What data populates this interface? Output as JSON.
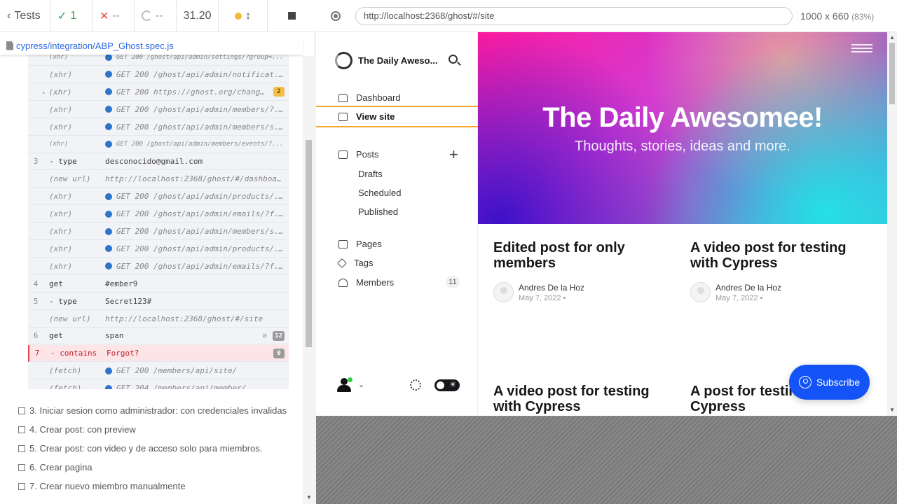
{
  "reporter": {
    "tests_label": "Tests",
    "passed": "1",
    "failed": "--",
    "pending": "--",
    "duration": "31.20",
    "spec_path": "cypress/integration/ABP_Ghost.spec.js"
  },
  "commands": [
    {
      "num": "",
      "name": "(xhr)",
      "msg": "GET 200 /ghost/api/admin/settings/?group=...",
      "dot": true,
      "style": "faded"
    },
    {
      "num": "",
      "name": "(xhr)",
      "msg": "GET 200 /ghost/api/admin/notificat...",
      "dot": true,
      "style": "italic"
    },
    {
      "num": "",
      "name": "(xhr)",
      "msg": "GET 200 https://ghost.org/change...",
      "dot": true,
      "style": "italic",
      "badge": "2",
      "badge_color": "yellow",
      "caret": true
    },
    {
      "num": "",
      "name": "(xhr)",
      "msg": "GET 200 /ghost/api/admin/members/?...",
      "dot": true,
      "style": "italic"
    },
    {
      "num": "",
      "name": "(xhr)",
      "msg": "GET 200 /ghost/api/admin/members/s...",
      "dot": true,
      "style": "italic"
    },
    {
      "num": "",
      "name": "(xhr)",
      "msg": "GET 200 /ghost/api/admin/members/events/?...",
      "dot": true,
      "style": "faded"
    },
    {
      "num": "3",
      "name": "- type",
      "msg": "desconocido@gmail.com",
      "style": "plain"
    },
    {
      "num": "",
      "name": "(new url)",
      "msg": "http://localhost:2368/ghost/#/dashboa...",
      "style": "italic"
    },
    {
      "num": "",
      "name": "(xhr)",
      "msg": "GET 200 /ghost/api/admin/products/...",
      "dot": true,
      "style": "italic"
    },
    {
      "num": "",
      "name": "(xhr)",
      "msg": "GET 200 /ghost/api/admin/emails/?f...",
      "dot": true,
      "style": "italic"
    },
    {
      "num": "",
      "name": "(xhr)",
      "msg": "GET 200 /ghost/api/admin/members/s...",
      "dot": true,
      "style": "italic"
    },
    {
      "num": "",
      "name": "(xhr)",
      "msg": "GET 200 /ghost/api/admin/products/...",
      "dot": true,
      "style": "italic"
    },
    {
      "num": "",
      "name": "(xhr)",
      "msg": "GET 200 /ghost/api/admin/emails/?f...",
      "dot": true,
      "style": "italic"
    },
    {
      "num": "4",
      "name": "get",
      "msg": "#ember9",
      "style": "plain"
    },
    {
      "num": "5",
      "name": "- type",
      "msg": "Secret123#",
      "style": "plain"
    },
    {
      "num": "",
      "name": "(new url)",
      "msg": "http://localhost:2368/ghost/#/site",
      "style": "italic"
    },
    {
      "num": "6",
      "name": "get",
      "msg": "span",
      "style": "plain",
      "badge": "12",
      "eye": true
    },
    {
      "num": "7",
      "name": "- contains",
      "msg": "Forgot?",
      "style": "failed",
      "badge": "0"
    },
    {
      "num": "",
      "name": "(fetch)",
      "msg": "GET 200 /members/api/site/",
      "dot": true,
      "style": "italic"
    },
    {
      "num": "",
      "name": "(fetch)",
      "msg": "GET 204 /members/api/member/",
      "dot": true,
      "style": "italic"
    }
  ],
  "tests": [
    "3. Iniciar sesion como administrador: con credenciales invalidas",
    "4. Crear post: con preview",
    "5. Crear post: con video y de acceso solo para miembros.",
    "6. Crear pagina",
    "7. Crear nuevo miembro manualmente"
  ],
  "browser": {
    "url": "http://localhost:2368/ghost/#/site",
    "viewport": "1000 x 660",
    "zoom": "(83%)"
  },
  "ghost": {
    "site_name": "The Daily Aweso...",
    "nav": {
      "dashboard": "Dashboard",
      "view_site": "View site",
      "posts": "Posts",
      "drafts": "Drafts",
      "scheduled": "Scheduled",
      "published": "Published",
      "pages": "Pages",
      "tags": "Tags",
      "members": "Members",
      "members_count": "11"
    },
    "hero_title": "The Daily Awesomee!",
    "hero_subtitle": "Thoughts, stories, ideas and more.",
    "posts": [
      {
        "title": "Edited post for only members",
        "author": "Andres De la Hoz",
        "date": "May 7, 2022 •"
      },
      {
        "title": "A video post for testing with Cypress",
        "author": "Andres De la Hoz",
        "date": "May 7, 2022 •"
      },
      {
        "title": "A video post for testing with Cypress",
        "author": "",
        "date": ""
      },
      {
        "title": "A post for testing Cypress",
        "author": "",
        "date": ""
      }
    ],
    "subscribe_label": "Subscribe"
  }
}
